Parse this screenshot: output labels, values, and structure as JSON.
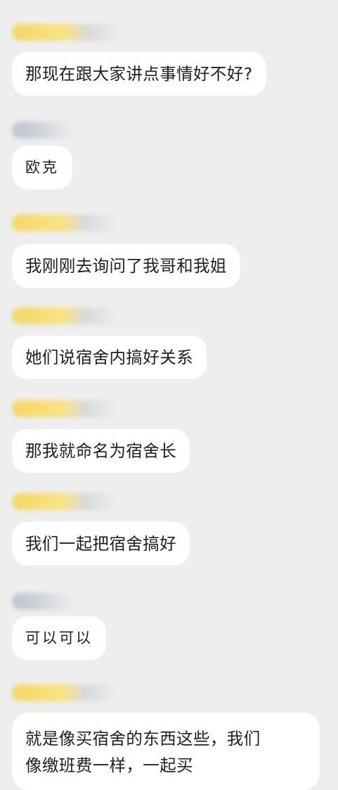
{
  "messages": [
    {
      "text": "那现在跟大家讲点事情好不好?"
    },
    {
      "text": "欧克"
    },
    {
      "text": "我刚刚去询问了我哥和我姐"
    },
    {
      "text": "她们说宿舍内搞好关系"
    },
    {
      "text": "那我就命名为宿舍长"
    },
    {
      "text": "我们一起把宿舍搞好"
    },
    {
      "text": "可以可以"
    },
    {
      "lines": [
        "就是像买宿舍的东西这些，我们",
        "像缴班费一样，一起买"
      ]
    }
  ],
  "colors": {
    "background": "#eeeeef",
    "bubble": "#ffffff",
    "sender_name_yellow": "#f4d55c",
    "sender_name_gray": "#bcc0cd"
  }
}
